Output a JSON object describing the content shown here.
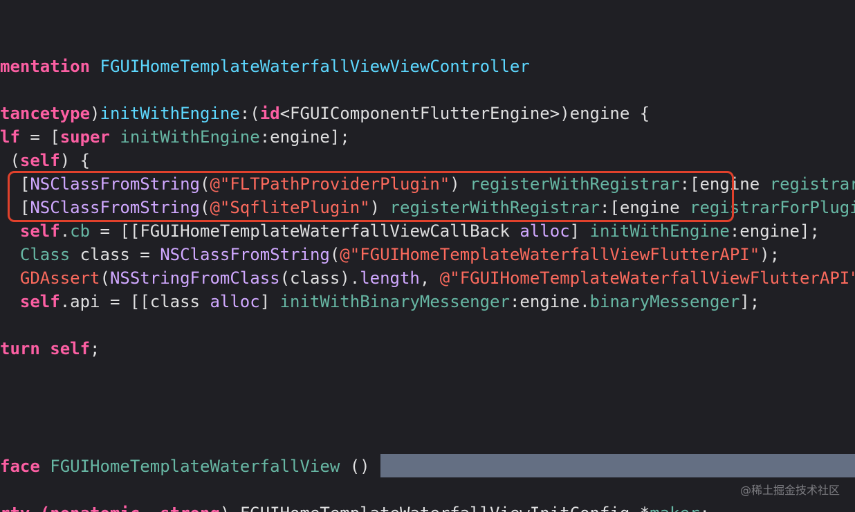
{
  "colors": {
    "background": "#1f1f24",
    "keyword": "#fc5fa3",
    "string": "#fc6a5d",
    "type": "#5dd8ff",
    "library": "#d0a8ff",
    "project": "#67b7a4",
    "plain": "#dfdfe0",
    "highlight_box": "#e0412c",
    "selection": "#646f83"
  },
  "code_lines": [
    {
      "tokens": [
        {
          "t": "mentation ",
          "k": "kw"
        },
        {
          "t": "FGUIHomeTemplateWaterfallViewViewController",
          "k": "type"
        }
      ]
    },
    {
      "tokens": [
        {
          "t": "tancetype",
          "k": "kw"
        },
        {
          "t": ")",
          "k": "plain"
        },
        {
          "t": "initWithEngine",
          "k": "type"
        },
        {
          "t": ":(",
          "k": "plain"
        },
        {
          "t": "id",
          "k": "kw"
        },
        {
          "t": "<FGUIComponentFlutterEngine>)engine {",
          "k": "plain"
        }
      ]
    },
    {
      "tokens": [
        {
          "t": "lf",
          "k": "kw"
        },
        {
          "t": " = [",
          "k": "plain"
        },
        {
          "t": "super",
          "k": "kw"
        },
        {
          "t": " ",
          "k": "plain"
        },
        {
          "t": "initWithEngine",
          "k": "proj"
        },
        {
          "t": ":engine];",
          "k": "plain"
        }
      ]
    },
    {
      "tokens": [
        {
          "t": " (",
          "k": "plain"
        },
        {
          "t": "self",
          "k": "kw"
        },
        {
          "t": ") {",
          "k": "plain"
        }
      ]
    },
    {
      "tokens": [
        {
          "t": "  [",
          "k": "plain"
        },
        {
          "t": "NSClassFromString",
          "k": "lib"
        },
        {
          "t": "(",
          "k": "plain"
        },
        {
          "t": "@\"FLTPathProviderPlugin\"",
          "k": "str"
        },
        {
          "t": ") ",
          "k": "plain"
        },
        {
          "t": "registerWithRegistrar",
          "k": "proj"
        },
        {
          "t": ":[engine ",
          "k": "plain"
        },
        {
          "t": "registrarForPlugin",
          "k": "proj"
        }
      ]
    },
    {
      "tokens": [
        {
          "t": "  [",
          "k": "plain"
        },
        {
          "t": "NSClassFromString",
          "k": "lib"
        },
        {
          "t": "(",
          "k": "plain"
        },
        {
          "t": "@\"SqflitePlugin\"",
          "k": "str"
        },
        {
          "t": ") ",
          "k": "plain"
        },
        {
          "t": "registerWithRegistrar",
          "k": "proj"
        },
        {
          "t": ":[engine ",
          "k": "plain"
        },
        {
          "t": "registrarForPlugin",
          "k": "proj"
        }
      ]
    },
    {
      "tokens": [
        {
          "t": "  ",
          "k": "plain"
        },
        {
          "t": "self",
          "k": "kw"
        },
        {
          "t": ".",
          "k": "plain"
        },
        {
          "t": "cb",
          "k": "proj"
        },
        {
          "t": " = [[",
          "k": "plain"
        },
        {
          "t": "FGUIHomeTemplateWaterfallViewCallBack",
          "k": "plain"
        },
        {
          "t": " ",
          "k": "plain"
        },
        {
          "t": "alloc",
          "k": "lib"
        },
        {
          "t": "] ",
          "k": "plain"
        },
        {
          "t": "initWithEngine",
          "k": "proj"
        },
        {
          "t": ":engine];",
          "k": "plain"
        }
      ]
    },
    {
      "tokens": [
        {
          "t": "  ",
          "k": "plain"
        },
        {
          "t": "Class",
          "k": "proj"
        },
        {
          "t": " class = ",
          "k": "plain"
        },
        {
          "t": "NSClassFromString",
          "k": "lib"
        },
        {
          "t": "(",
          "k": "plain"
        },
        {
          "t": "@\"FGUIHomeTemplateWaterfallViewFlutterAPI\"",
          "k": "str"
        },
        {
          "t": ");",
          "k": "plain"
        }
      ]
    },
    {
      "tokens": [
        {
          "t": "  ",
          "k": "plain"
        },
        {
          "t": "GDAssert",
          "k": "str"
        },
        {
          "t": "(",
          "k": "plain"
        },
        {
          "t": "NSStringFromClass",
          "k": "lib"
        },
        {
          "t": "(class).",
          "k": "plain"
        },
        {
          "t": "length",
          "k": "lib"
        },
        {
          "t": ", ",
          "k": "plain"
        },
        {
          "t": "@\"FGUIHomeTemplateWaterfallViewFlutterAPI\"",
          "k": "str"
        }
      ]
    },
    {
      "tokens": [
        {
          "t": "  ",
          "k": "plain"
        },
        {
          "t": "self",
          "k": "kw"
        },
        {
          "t": ".api = [[class ",
          "k": "plain"
        },
        {
          "t": "alloc",
          "k": "lib"
        },
        {
          "t": "] ",
          "k": "plain"
        },
        {
          "t": "initWithBinaryMessenger",
          "k": "proj"
        },
        {
          "t": ":engine.",
          "k": "plain"
        },
        {
          "t": "binaryMessenger",
          "k": "proj"
        },
        {
          "t": "];",
          "k": "plain"
        }
      ]
    },
    {
      "tokens": [
        {
          "t": "turn",
          "k": "kw"
        },
        {
          "t": " ",
          "k": "plain"
        },
        {
          "t": "self",
          "k": "kw"
        },
        {
          "t": ";",
          "k": "plain"
        }
      ]
    },
    {
      "tokens": [
        {
          "t": "face ",
          "k": "kw"
        },
        {
          "t": "FGUIHomeTemplateWaterfallView",
          "k": "proj"
        },
        {
          "t": " ()",
          "k": "plain"
        }
      ]
    },
    {
      "tokens": [
        {
          "t": "rty (",
          "k": "kw"
        },
        {
          "t": "nonatomic",
          "k": "kw"
        },
        {
          "t": ", ",
          "k": "plain"
        },
        {
          "t": "strong",
          "k": "kw"
        },
        {
          "t": ") ",
          "k": "plain"
        },
        {
          "t": "FGUIHomeTemplateWaterfallViewInitConfig",
          "k": "plain"
        },
        {
          "t": " *",
          "k": "plain"
        },
        {
          "t": "maker",
          "k": "proj"
        },
        {
          "t": ";",
          "k": "plain"
        }
      ]
    }
  ],
  "watermark": "@稀土掘金技术社区"
}
